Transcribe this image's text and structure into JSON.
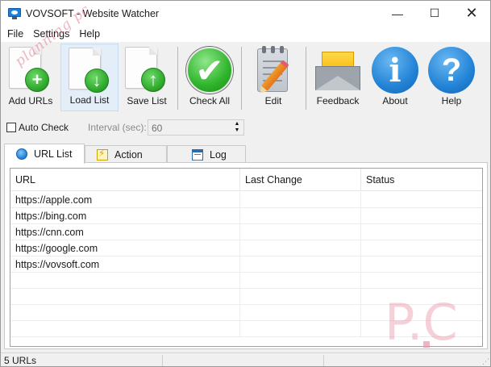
{
  "window": {
    "title": "VOVSOFT - Website Watcher",
    "minimize_glyph": "—",
    "maximize_glyph": "☐",
    "close_glyph": "✕"
  },
  "menu": [
    "File",
    "Settings",
    "Help"
  ],
  "toolbar": {
    "add_urls": "Add URLs",
    "load_list": "Load List",
    "save_list": "Save List",
    "check_all": "Check All",
    "edit": "Edit",
    "feedback": "Feedback",
    "about": "About",
    "help": "Help"
  },
  "options": {
    "auto_check_label": "Auto Check",
    "auto_check_checked": false,
    "interval_label": "Interval (sec):",
    "interval_value": "60"
  },
  "tabs": [
    {
      "label": "URL List",
      "active": true,
      "icon": "globe-icon"
    },
    {
      "label": "Action",
      "active": false,
      "icon": "lightning-icon"
    },
    {
      "label": "Log",
      "active": false,
      "icon": "log-icon"
    }
  ],
  "grid": {
    "columns": [
      "URL",
      "Last Change",
      "Status"
    ],
    "rows": [
      [
        "https://apple.com",
        "",
        ""
      ],
      [
        "https://bing.com",
        "",
        ""
      ],
      [
        "https://cnn.com",
        "",
        ""
      ],
      [
        "https://google.com",
        "",
        ""
      ],
      [
        "https://vovsoft.com",
        "",
        ""
      ],
      [
        "",
        "",
        ""
      ],
      [
        "",
        "",
        ""
      ],
      [
        "",
        "",
        ""
      ],
      [
        "",
        "",
        ""
      ]
    ]
  },
  "watermark": {
    "diagonal_text": "planning pc",
    "corner_text": "P.C"
  },
  "status": {
    "count_text": "5 URLs"
  },
  "colors": {
    "accent_blue": "#2283d6",
    "accent_green": "#2fb42c",
    "feedback_yellow": "#f5b400"
  }
}
